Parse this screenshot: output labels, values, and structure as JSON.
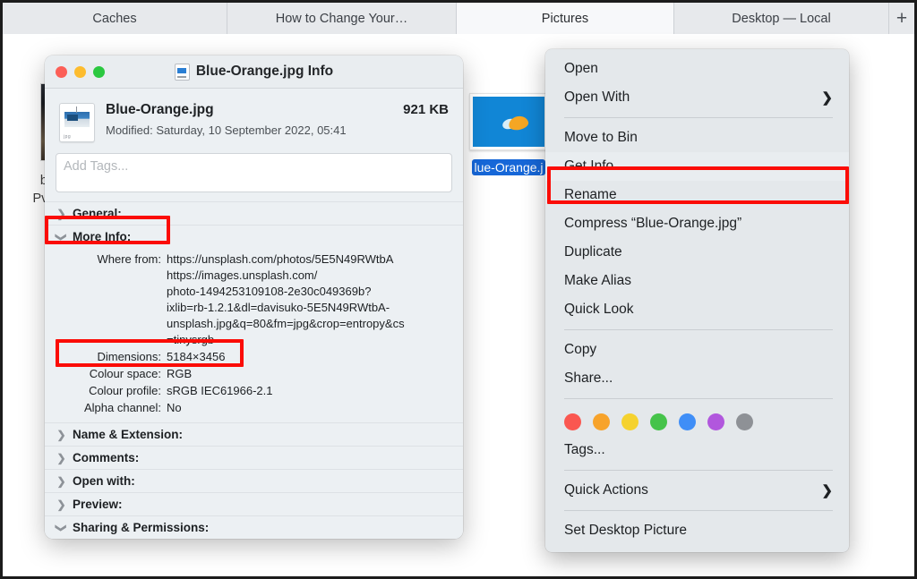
{
  "tabs": [
    {
      "label": "Caches",
      "active": false
    },
    {
      "label": "How to Change Your…",
      "active": false
    },
    {
      "label": "Pictures",
      "active": true
    },
    {
      "label": "Desktop — Local",
      "active": false
    }
  ],
  "new_tab_label": "+",
  "finder": {
    "background_file": {
      "label_line1": "britt",
      "label_line2": "PvetM"
    },
    "selected_file": {
      "label": "lue-Orange.j"
    }
  },
  "info_window": {
    "title": "Blue-Orange.jpg Info",
    "file_name": "Blue-Orange.jpg",
    "file_size": "921 KB",
    "modified": "Modified: Saturday, 10 September 2022, 05:41",
    "icon_caption": "jpg",
    "tags_placeholder": "Add Tags...",
    "sections": {
      "general": "General:",
      "more_info": "More Info:",
      "name_extension": "Name & Extension:",
      "comments": "Comments:",
      "open_with": "Open with:",
      "preview": "Preview:",
      "sharing_permissions": "Sharing & Permissions:"
    },
    "more_info_rows": [
      {
        "label": "Where from:",
        "value_lines": [
          "https://unsplash.com/photos/5E5N49RWtbA",
          "https://images.unsplash.com/",
          "photo-1494253109108-2e30c049369b?",
          "ixlib=rb-1.2.1&dl=davisuko-5E5N49RWtbA-",
          "unsplash.jpg&q=80&fm=jpg&crop=entropy&cs",
          "=tinysrgb"
        ]
      },
      {
        "label": "Dimensions:",
        "value_lines": [
          "5184×3456"
        ]
      },
      {
        "label": "Colour space:",
        "value_lines": [
          "RGB"
        ]
      },
      {
        "label": "Colour profile:",
        "value_lines": [
          "sRGB IEC61966-2.1"
        ]
      },
      {
        "label": "Alpha channel:",
        "value_lines": [
          "No"
        ]
      }
    ]
  },
  "context_menu": {
    "items": [
      {
        "label": "Open",
        "submenu": false,
        "highlight": false
      },
      {
        "label": "Open With",
        "submenu": true,
        "highlight": false
      },
      {
        "label": "Move to Bin",
        "submenu": false,
        "highlight": false
      },
      {
        "label": "Get Info",
        "submenu": false,
        "highlight": true
      },
      {
        "label": "Rename",
        "submenu": false,
        "highlight": false
      },
      {
        "label": "Compress “Blue-Orange.jpg”",
        "submenu": false,
        "highlight": false
      },
      {
        "label": "Duplicate",
        "submenu": false,
        "highlight": false
      },
      {
        "label": "Make Alias",
        "submenu": false,
        "highlight": false
      },
      {
        "label": "Quick Look",
        "submenu": false,
        "highlight": false
      },
      {
        "label": "Copy",
        "submenu": false,
        "highlight": false
      },
      {
        "label": "Share...",
        "submenu": false,
        "highlight": false
      },
      {
        "label": "Tags...",
        "submenu": false,
        "highlight": false
      },
      {
        "label": "Quick Actions",
        "submenu": true,
        "highlight": false
      },
      {
        "label": "Set Desktop Picture",
        "submenu": false,
        "highlight": false
      }
    ],
    "submenu_arrow": "❯",
    "tag_colors": [
      "#fa5750",
      "#f7a32b",
      "#f5d22f",
      "#45c34a",
      "#3f8ef7",
      "#b157dd",
      "#8e9196"
    ]
  },
  "annotations": {
    "color": "#fb0c06",
    "boxes": [
      "More Info:",
      "Dimensions: 5184×3456",
      "Get Info"
    ]
  }
}
